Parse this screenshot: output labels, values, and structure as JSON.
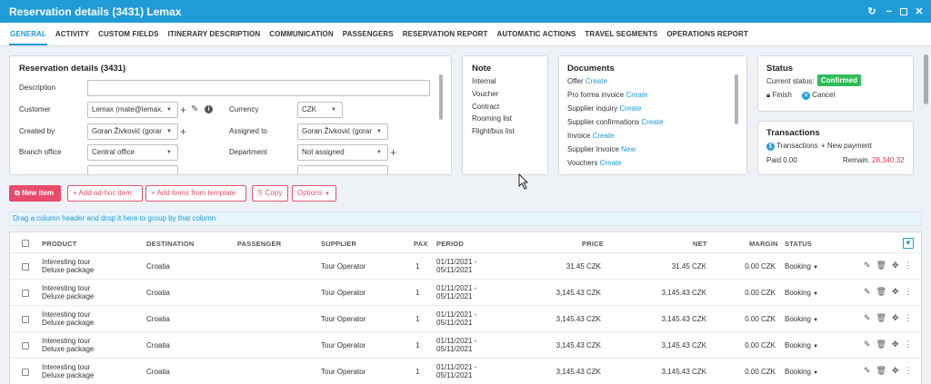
{
  "window": {
    "title": "Reservation details (3431) Lemax",
    "controls": [
      "refresh-icon",
      "minimize-icon",
      "maximize-icon",
      "close-icon"
    ]
  },
  "tabs": [
    "GENERAL",
    "ACTIVITY",
    "CUSTOM FIELDS",
    "ITINERARY DESCRIPTION",
    "COMMUNICATION",
    "PASSENGERS",
    "RESERVATION REPORT",
    "AUTOMATIC ACTIONS",
    "TRAVEL SEGMENTS",
    "OPERATIONS REPORT"
  ],
  "details": {
    "title": "Reservation details (3431)",
    "description_label": "Description",
    "description_value": "",
    "customer_label": "Customer",
    "customer_value": "Lemax (mate@lemax.",
    "currency_label": "Currency",
    "currency_value": "CZK",
    "created_by_label": "Created by",
    "created_by_value": "Goran Živković (gorar",
    "assigned_to_label": "Assigned to",
    "assigned_to_value": "Goran Živković (gorar",
    "branch_label": "Branch office",
    "branch_value": "Central office",
    "department_label": "Department",
    "department_value": "Not assigned"
  },
  "note": {
    "title": "Note",
    "links": [
      "Internal",
      "Voucher",
      "Contract",
      "Rooming list",
      "Flight/bus list"
    ]
  },
  "documents": {
    "title": "Documents",
    "items": [
      {
        "label": "Offer",
        "action": "Create"
      },
      {
        "label": "Pro forma invoice",
        "action": "Create"
      },
      {
        "label": "Supplier inquiry",
        "action": "Create"
      },
      {
        "label": "Supplier confirmations",
        "action": "Create"
      },
      {
        "label": "Invoice",
        "action": "Create"
      },
      {
        "label": "Supplier Invoice",
        "action": "New"
      },
      {
        "label": "Vouchers",
        "action": "Create"
      }
    ]
  },
  "status": {
    "title": "Status",
    "current_label": "Current status:",
    "current_value": "Confirmed",
    "finish": "Finish",
    "cancel": "Cancel",
    "badge_color": "#2ebd59"
  },
  "transactions": {
    "title": "Transactions",
    "link": "Transactions",
    "new_payment": "New payment",
    "paid": "Paid 0.00",
    "remain_label": "Remain.",
    "remain_value": "28,340.32"
  },
  "toolbar": {
    "new_item": "New item",
    "add_adhoc": "Add ad-hoc item",
    "add_template": "Add items from template",
    "copy": "Copy",
    "options": "Options"
  },
  "group_hint": "Drag a column header and drop it here to group by that column",
  "grid": {
    "columns": [
      "PRODUCT",
      "DESTINATION",
      "PASSENGER",
      "SUPPLIER",
      "PAX",
      "PERIOD",
      "PRICE",
      "NET",
      "MARGIN",
      "STATUS"
    ],
    "rows": [
      {
        "product1": "Interesting tour",
        "product2": "Deluxe package",
        "destination": "Croatia",
        "passenger": "",
        "supplier": "Tour Operator",
        "pax": "1",
        "period1": "01/11/2021 -",
        "period2": "05/11/2021",
        "price": "31.45 CZK",
        "net": "31.45 CZK",
        "margin": "0.00 CZK",
        "status": "Booking"
      },
      {
        "product1": "Interesting tour",
        "product2": "Deluxe package",
        "destination": "Croatia",
        "passenger": "",
        "supplier": "Tour Operator",
        "pax": "1",
        "period1": "01/11/2021 -",
        "period2": "05/11/2021",
        "price": "3,145.43 CZK",
        "net": "3,145.43 CZK",
        "margin": "0.00 CZK",
        "status": "Booking"
      },
      {
        "product1": "Interesting tour",
        "product2": "Deluxe package",
        "destination": "Croatia",
        "passenger": "",
        "supplier": "Tour Operator",
        "pax": "1",
        "period1": "01/11/2021 -",
        "period2": "05/11/2021",
        "price": "3,145.43 CZK",
        "net": "3,145.43 CZK",
        "margin": "0.00 CZK",
        "status": "Booking"
      },
      {
        "product1": "Interesting tour",
        "product2": "Deluxe package",
        "destination": "Croatia",
        "passenger": "",
        "supplier": "Tour Operator",
        "pax": "1",
        "period1": "01/11/2021 -",
        "period2": "05/11/2021",
        "price": "3,145.43 CZK",
        "net": "3,145.43 CZK",
        "margin": "0.00 CZK",
        "status": "Booking"
      },
      {
        "product1": "Interesting tour",
        "product2": "Deluxe package",
        "destination": "Croatia",
        "passenger": "",
        "supplier": "Tour Operator",
        "pax": "1",
        "period1": "01/11/2021 -",
        "period2": "05/11/2021",
        "price": "3,145.43 CZK",
        "net": "3,145.43 CZK",
        "margin": "0.00 CZK",
        "status": "Booking"
      }
    ]
  },
  "colors": {
    "accent": "#1f9bd7",
    "primary_button": "#e84c6a",
    "remain": "#e0334a"
  }
}
